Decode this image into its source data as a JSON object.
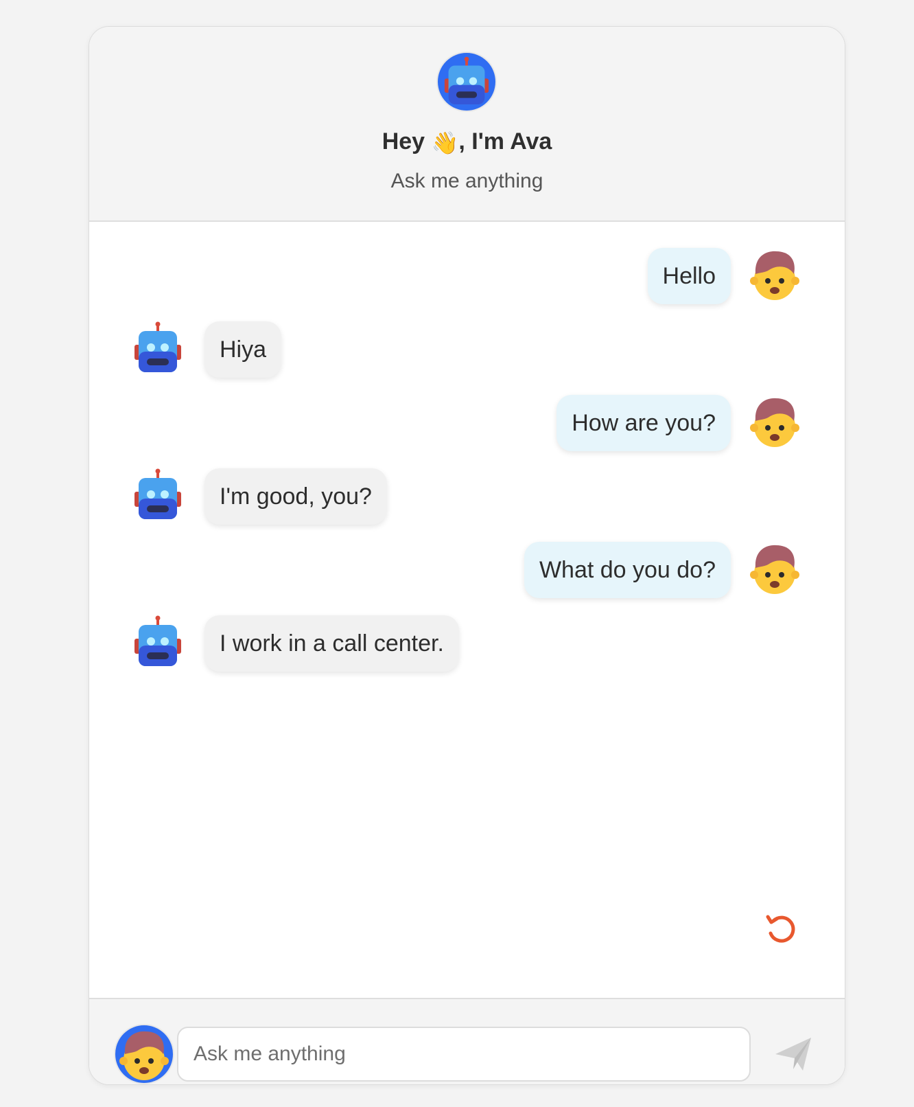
{
  "header": {
    "title_prefix": "Hey ",
    "wave_emoji": "👋",
    "title_suffix": ", I'm Ava",
    "subtitle": "Ask me anything",
    "avatar_icon": "robot-icon",
    "avatar_color": "#2f6df2"
  },
  "messages": [
    {
      "sender": "user",
      "text": "Hello"
    },
    {
      "sender": "bot",
      "text": "Hiya"
    },
    {
      "sender": "user",
      "text": "How are you?"
    },
    {
      "sender": "bot",
      "text": "I'm good, you?"
    },
    {
      "sender": "user",
      "text": "What do you do?"
    },
    {
      "sender": "bot",
      "text": "I work in a call center."
    }
  ],
  "colors": {
    "user_bubble": "#e6f5fb",
    "bot_bubble": "#f1f1f1",
    "reset_icon": "#e8582e",
    "send_icon": "#c9c9c9"
  },
  "reset_icon": "refresh-icon",
  "composer": {
    "placeholder": "Ask me anything",
    "value": "",
    "send_icon": "send-icon",
    "avatar_icon": "boy-face-icon"
  }
}
